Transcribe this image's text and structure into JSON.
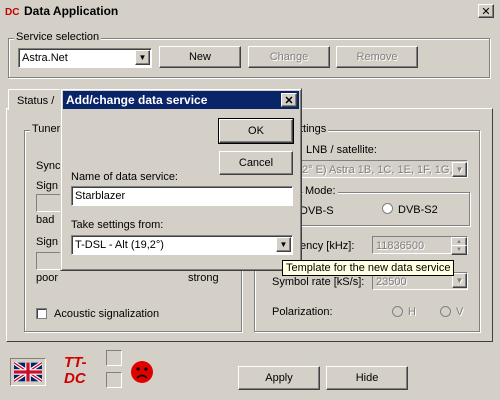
{
  "window": {
    "title": "Data Application"
  },
  "service_selection": {
    "legend": "Service selection",
    "selected": "Astra.Net",
    "new_label": "New",
    "change_label": "Change",
    "remove_label": "Remove"
  },
  "tabs": {
    "status_label": "Status /"
  },
  "tuner": {
    "legend": "Tuner",
    "sync_label": "Sync",
    "signal1_label": "Sign",
    "bad_label": "bad",
    "signal2_label": "Sign",
    "poor_label": "poor",
    "strong_label": "strong",
    "acoustic_label": "Acoustic signalization"
  },
  "settings": {
    "legend": "ttings",
    "lnb_label": "LNB / satellite:",
    "lnb_value": "2° E) Astra 1B, 1C, 1E, 1F, 1G,",
    "mode_label": "Mode:",
    "dvbs_label": "DVB-S",
    "dvbs2_label": "DVB-S2",
    "frequency_label": "ency [kHz]:",
    "frequency_value": "11836500",
    "symbol_label": "Symbol rate [kS/s]:",
    "symbol_value": "23500",
    "polarization_label": "Polarization:",
    "pol_h": "H",
    "pol_v": "V"
  },
  "footer": {
    "apply_label": "Apply",
    "hide_label": "Hide",
    "logo_text_top": "TT-",
    "logo_text_bottom": "DC"
  },
  "dialog": {
    "title": "Add/change data service",
    "ok_label": "OK",
    "cancel_label": "Cancel",
    "name_label": "Name of data service:",
    "name_value": "Starblazer",
    "take_label": "Take settings from:",
    "take_value": "T-DSL - Alt (19,2°)"
  },
  "tooltip": {
    "text": "Template for the new data service"
  },
  "icons": {
    "app": "app-icon",
    "close": "close-icon",
    "flag": "uk-flag-icon",
    "status": "sad-face-icon"
  },
  "colors": {
    "titlebar": "#0a246a",
    "face": "#d4d0c8",
    "tooltip": "#ffffe1",
    "status_red": "#e00000"
  }
}
